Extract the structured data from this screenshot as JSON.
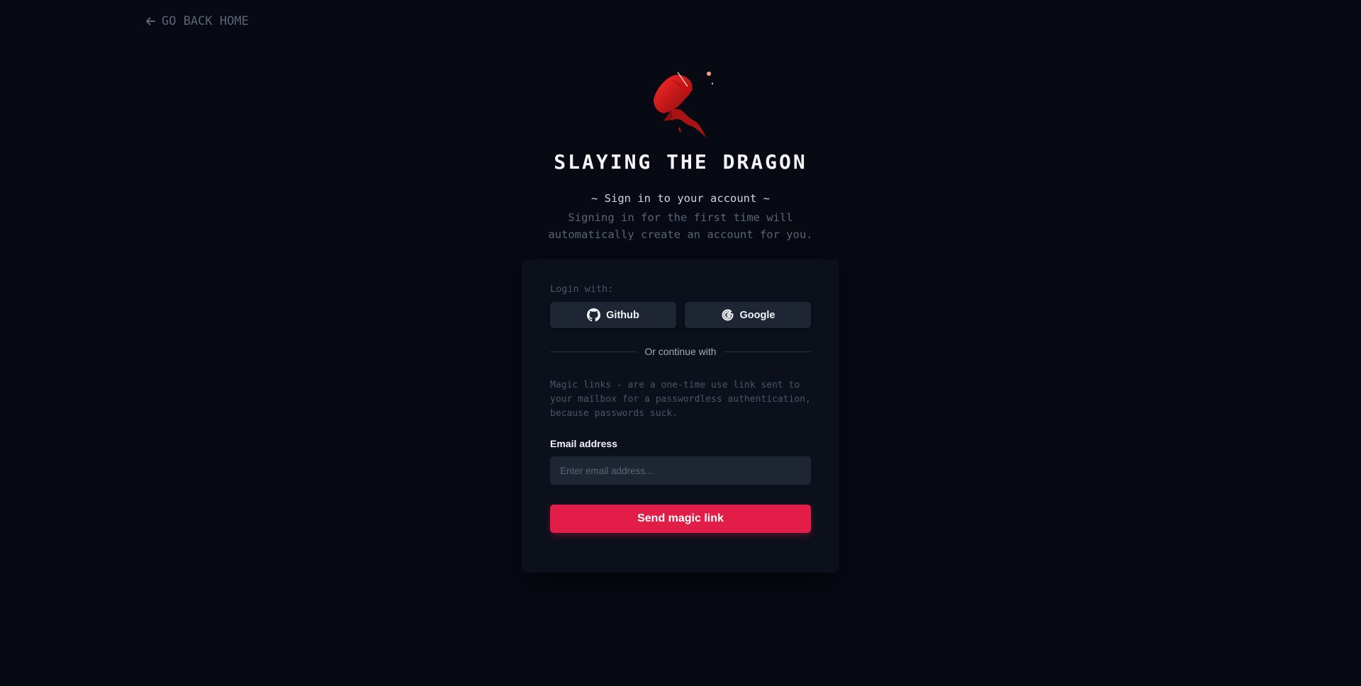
{
  "nav": {
    "back_label": "GO BACK HOME",
    "back_icon": "arrow-left-icon"
  },
  "hero": {
    "logo": "dragon-slayer-logo",
    "title": "SLAYING THE DRAGON",
    "subtitle": "~ Sign in to your account ~",
    "note": "Signing in for the first time will automatically create an account for you."
  },
  "card": {
    "login_label": "Login with:",
    "github_label": "Github",
    "github_icon": "github-icon",
    "google_label": "Google",
    "google_icon": "google-icon",
    "divider_text": "Or continue with",
    "magic_note": "Magic links - are a one-time use link sent to your mailbox for a passwordless authentication, because passwords suck.",
    "email_label": "Email address",
    "email_placeholder": "Enter email address...",
    "email_value": "",
    "send_label": "Send magic link"
  },
  "colors": {
    "background": "#070a13",
    "card": "#0b101b",
    "accent": "#e11d48",
    "button": "#1e2533"
  }
}
